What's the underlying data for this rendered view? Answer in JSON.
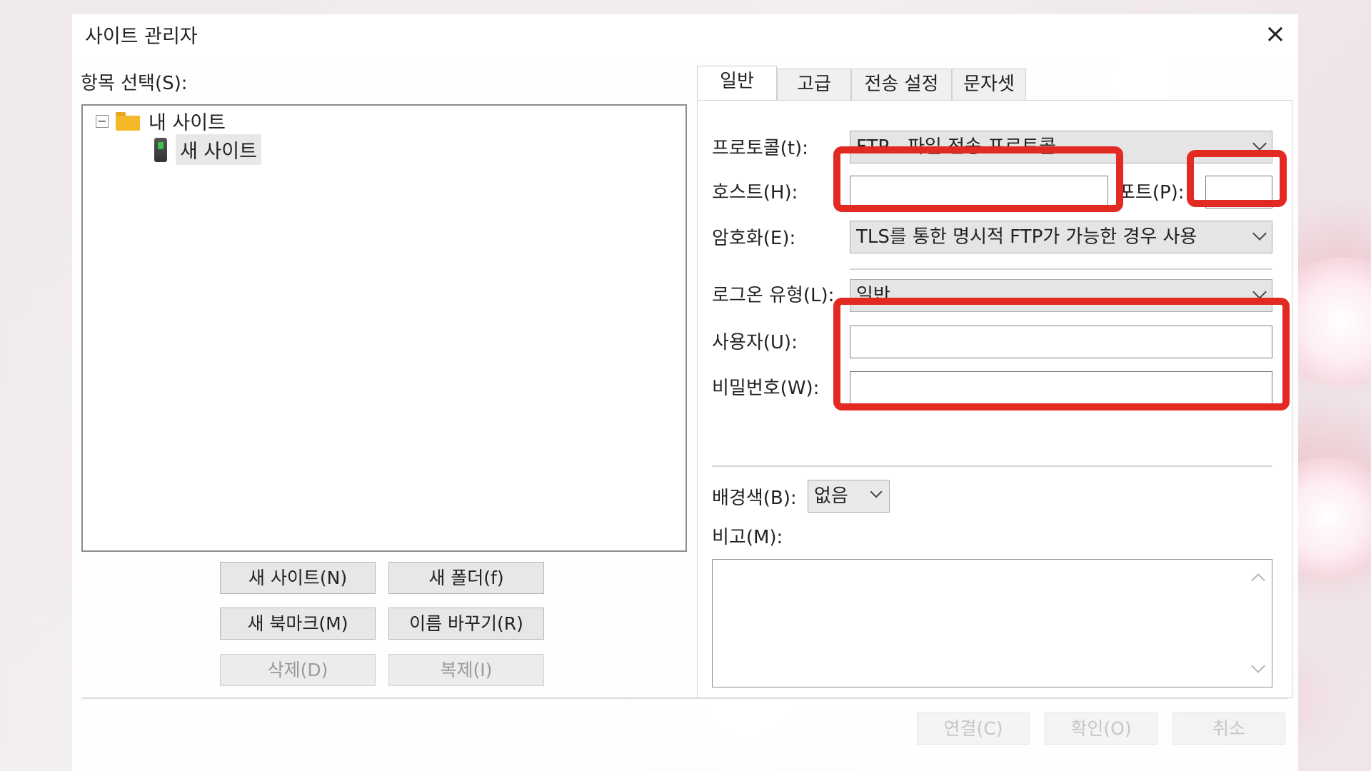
{
  "window": {
    "title": "사이트 관리자",
    "close_icon": "×"
  },
  "tree": {
    "section_label": "항목 선택(S):",
    "expander": "−",
    "root_label": "내 사이트",
    "child_label": "새 사이트"
  },
  "left_buttons": {
    "new_site": "새 사이트(N)",
    "new_folder": "새 폴더(f)",
    "new_bookmark": "새 북마크(M)",
    "rename": "이름 바꾸기(R)",
    "delete": "삭제(D)",
    "duplicate": "복제(I)"
  },
  "tabs": [
    {
      "label": "일반"
    },
    {
      "label": "고급"
    },
    {
      "label": "전송 설정"
    },
    {
      "label": "문자셋"
    }
  ],
  "general": {
    "protocol_label": "프로토콜(t):",
    "protocol_value": "FTP - 파일 전송 프로토콜",
    "host_label": "호스트(H):",
    "host_value": "",
    "port_label": "포트(P):",
    "port_value": "",
    "encryption_label": "암호화(E):",
    "encryption_value": "TLS를 통한 명시적 FTP가 가능한 경우 사용",
    "logon_label": "로그온 유형(L):",
    "logon_value": "일반",
    "user_label": "사용자(U):",
    "user_value": "",
    "password_label": "비밀번호(W):",
    "password_value": "",
    "bgcolor_label": "배경색(B):",
    "bgcolor_value": "없음",
    "memo_label": "비고(M):"
  },
  "footer_buttons": {
    "connect": "연결(C)",
    "ok": "확인(O)",
    "cancel": "취소"
  },
  "colors": {
    "highlight": "#e22a22",
    "folder": "#f5b829"
  }
}
